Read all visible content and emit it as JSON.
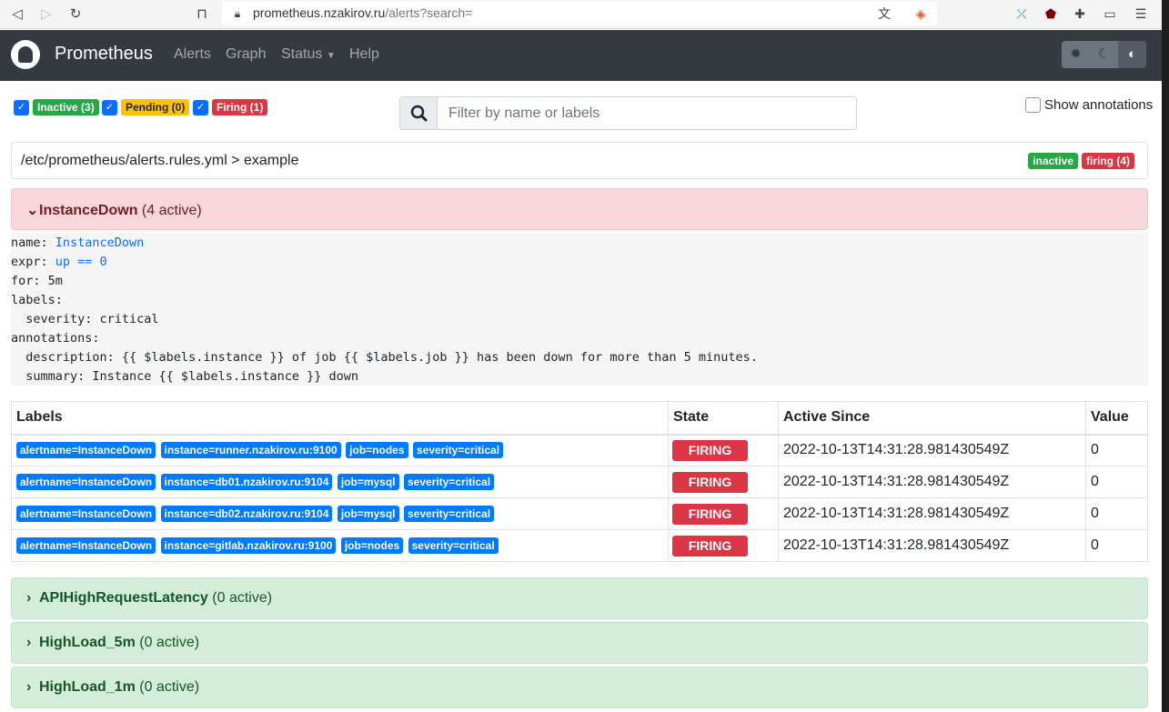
{
  "browser": {
    "url_host": "prometheus.nzakirov.ru",
    "url_path": "/alerts?search="
  },
  "navbar": {
    "brand": "Prometheus",
    "links": [
      "Alerts",
      "Graph",
      "Status",
      "Help"
    ]
  },
  "filters": {
    "inactive": "Inactive (3)",
    "pending": "Pending (0)",
    "firing": "Firing (1)",
    "search_placeholder": "Filter by name or labels",
    "show_annotations": "Show annotations"
  },
  "group": {
    "path": "/etc/prometheus/alerts.rules.yml > example",
    "badge_inactive": "inactive",
    "badge_firing": "firing (4)"
  },
  "rules": [
    {
      "name": "InstanceDown",
      "count": "(4 active)",
      "state": "firing"
    },
    {
      "name": "APIHighRequestLatency",
      "count": "(0 active)",
      "state": "inactive"
    },
    {
      "name": "HighLoad_5m",
      "count": "(0 active)",
      "state": "inactive"
    },
    {
      "name": "HighLoad_1m",
      "count": "(0 active)",
      "state": "inactive"
    }
  ],
  "rule_def": {
    "name_key": "name: ",
    "name_val": "InstanceDown",
    "expr_key": "expr: ",
    "expr_val": "up == 0",
    "for_line": "for: 5m",
    "labels_line": "labels:",
    "severity_line": "  severity: critical",
    "annotations_line": "annotations:",
    "description_line": "  description: {{ $labels.instance }} of job {{ $labels.job }} has been down for more than 5 minutes.",
    "summary_line": "  summary: Instance {{ $labels.instance }} down"
  },
  "table": {
    "headers": [
      "Labels",
      "State",
      "Active Since",
      "Value"
    ],
    "rows": [
      {
        "labels": [
          "alertname=InstanceDown",
          "instance=runner.nzakirov.ru:9100",
          "job=nodes",
          "severity=critical"
        ],
        "state": "FIRING",
        "since": "2022-10-13T14:31:28.981430549Z",
        "value": "0"
      },
      {
        "labels": [
          "alertname=InstanceDown",
          "instance=db01.nzakirov.ru:9104",
          "job=mysql",
          "severity=critical"
        ],
        "state": "FIRING",
        "since": "2022-10-13T14:31:28.981430549Z",
        "value": "0"
      },
      {
        "labels": [
          "alertname=InstanceDown",
          "instance=db02.nzakirov.ru:9104",
          "job=mysql",
          "severity=critical"
        ],
        "state": "FIRING",
        "since": "2022-10-13T14:31:28.981430549Z",
        "value": "0"
      },
      {
        "labels": [
          "alertname=InstanceDown",
          "instance=gitlab.nzakirov.ru:9100",
          "job=nodes",
          "severity=critical"
        ],
        "state": "FIRING",
        "since": "2022-10-13T14:31:28.981430549Z",
        "value": "0"
      }
    ]
  },
  "colors": {
    "firing": "#dc3545",
    "inactive": "#28a745",
    "pending": "#ffc107",
    "label": "#007bff"
  }
}
